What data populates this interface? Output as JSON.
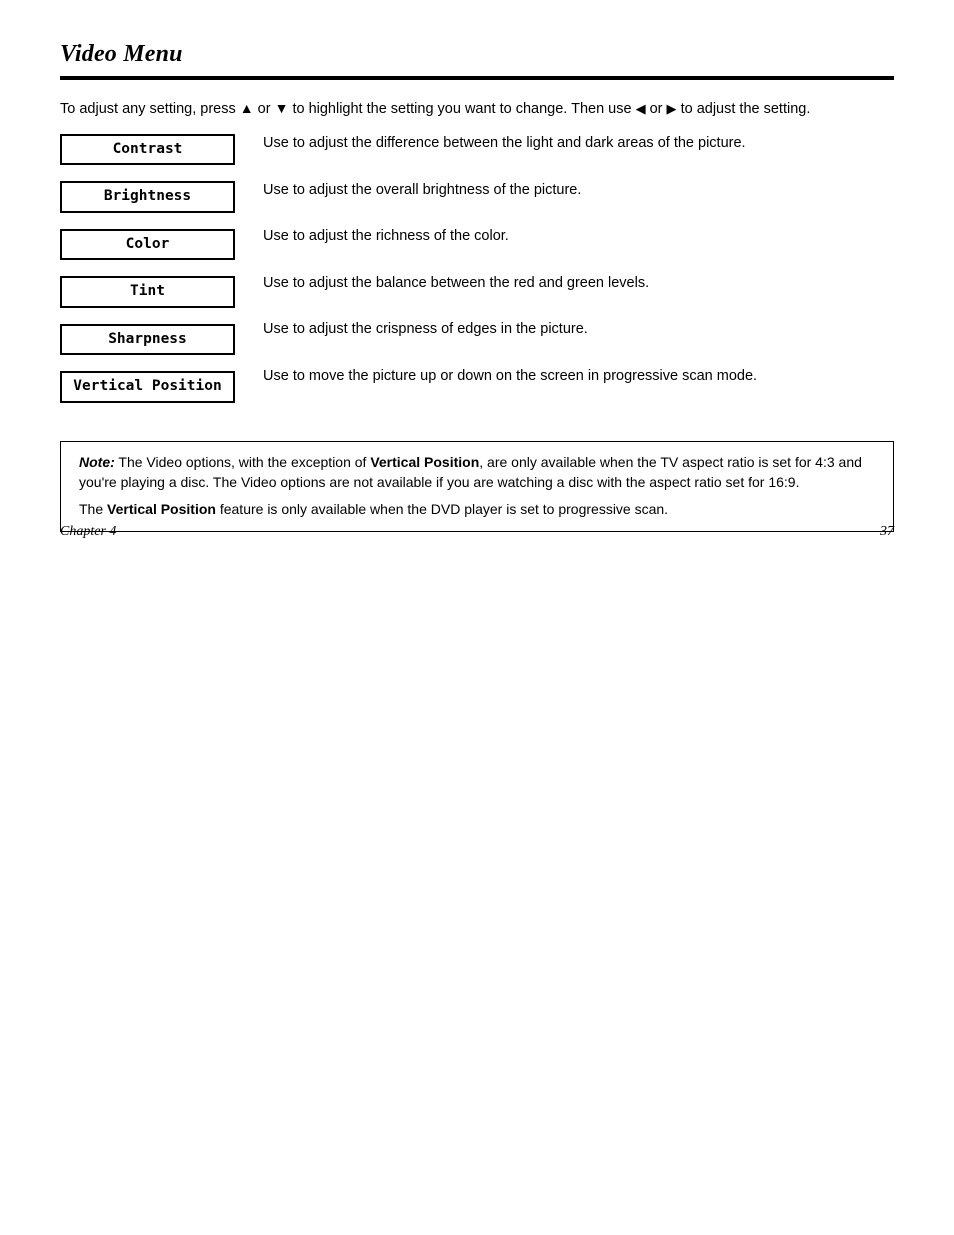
{
  "header": {
    "title": "Video Menu"
  },
  "intro": {
    "segments": [
      "To adjust any setting, press ",
      " or ",
      " to highlight the setting you want to change. Then use ",
      " or ",
      " to adjust the setting."
    ]
  },
  "menu": {
    "items": [
      {
        "id": "contrast",
        "label": "Contrast"
      },
      {
        "id": "brightness",
        "label": "Brightness"
      },
      {
        "id": "color",
        "label": "Color"
      },
      {
        "id": "tint",
        "label": "Tint"
      },
      {
        "id": "sharpness",
        "label": "Sharpness"
      },
      {
        "id": "vposition",
        "label": "Vertical Position"
      }
    ]
  },
  "descriptions": {
    "contrast": "Use to adjust the difference between the light and dark areas of the picture.",
    "brightness": "Use to adjust the overall brightness of the picture.",
    "color": "Use to adjust the richness of the color.",
    "tint": "Use to adjust the balance between the red and green levels.",
    "sharpness": "Use to adjust the crispness of edges in the picture.",
    "vposition": "Use to move the picture up or down on the screen in progressive scan mode."
  },
  "note": {
    "label": "Note:",
    "para1_before": "The Video options, with the exception of ",
    "para1_menu": "Vertical Position",
    "para1_after": ", are only available when the TV aspect ratio is set for 4:3 and you're playing a disc. The Video options are not available if you are watching a disc with the aspect ratio set for 16:9.",
    "para2_before": "The ",
    "para2_menu": "Vertical Position",
    "para2_after": " feature is only available when the DVD player is set to progressive scan."
  },
  "footer": {
    "left": "Chapter 4",
    "right": "37"
  }
}
